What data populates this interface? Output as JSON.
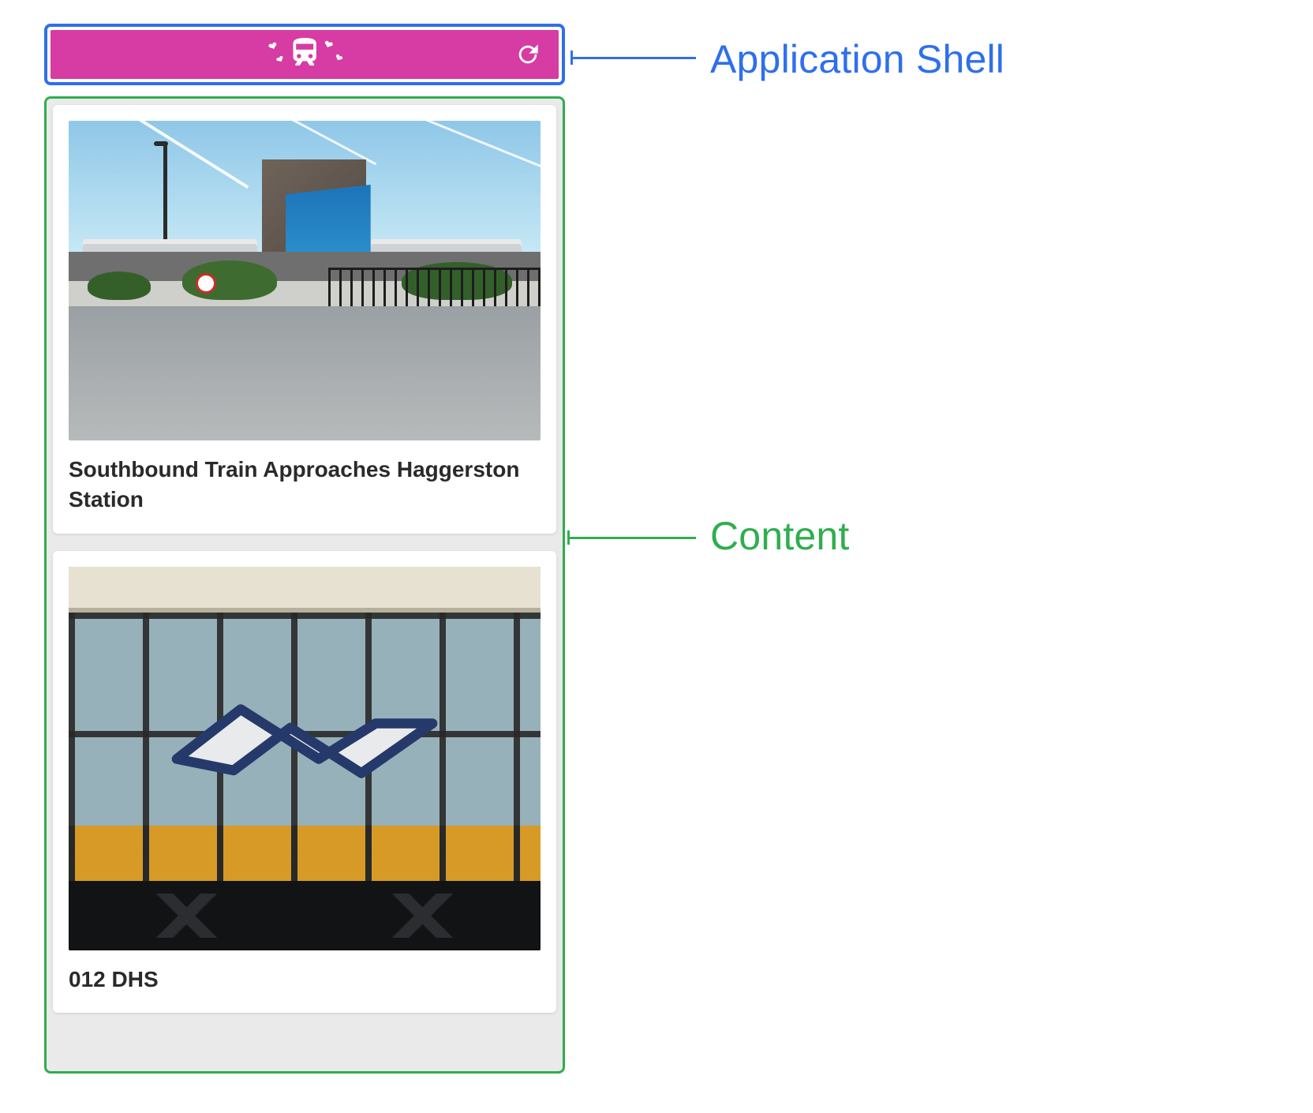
{
  "labels": {
    "shell": "Application Shell",
    "content": "Content"
  },
  "header": {
    "logo_icon": "train-with-hearts-icon",
    "refresh_icon": "refresh-icon"
  },
  "cards": [
    {
      "title": "Southbound Train Approaches Haggerston Station"
    },
    {
      "title": "012 DHS"
    }
  ],
  "colors": {
    "shell_border": "#2F6FED",
    "content_border": "#2FAE4E",
    "header_bg": "#D63CA3"
  }
}
